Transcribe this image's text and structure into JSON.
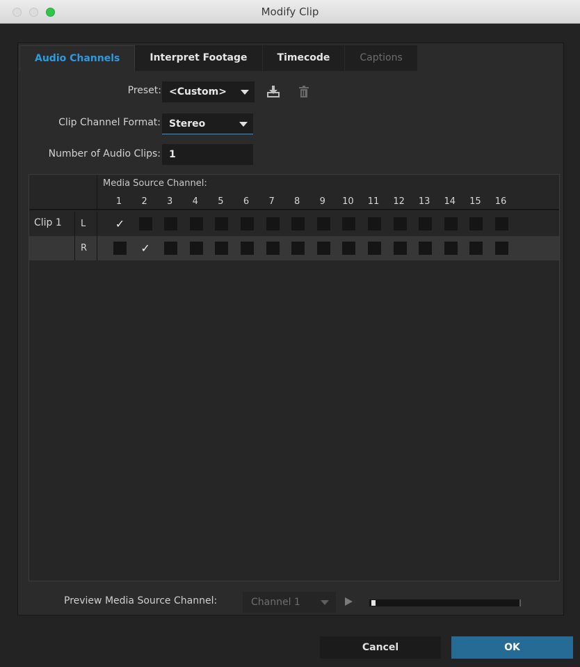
{
  "window": {
    "title": "Modify Clip"
  },
  "tabs": [
    {
      "label": "Audio Channels",
      "state": "active"
    },
    {
      "label": "Interpret Footage",
      "state": "normal"
    },
    {
      "label": "Timecode",
      "state": "normal"
    },
    {
      "label": "Captions",
      "state": "disabled"
    }
  ],
  "preset": {
    "label": "Preset:",
    "value": "<Custom>",
    "save_icon": "save-preset-icon",
    "delete_icon": "trash-icon"
  },
  "channel_format": {
    "label": "Clip Channel Format:",
    "value": "Stereo"
  },
  "audio_clips": {
    "label": "Number of Audio Clips:",
    "value": "1"
  },
  "grid": {
    "header": "Media Source Channel:",
    "channels": [
      "1",
      "2",
      "3",
      "4",
      "5",
      "6",
      "7",
      "8",
      "9",
      "10",
      "11",
      "12",
      "13",
      "14",
      "15",
      "16"
    ],
    "clip_label": "Clip 1",
    "rows": [
      {
        "channel": "L",
        "checked": [
          1
        ]
      },
      {
        "channel": "R",
        "checked": [
          2
        ]
      }
    ]
  },
  "preview": {
    "label": "Preview Media Source Channel:",
    "value": "Channel 1"
  },
  "buttons": {
    "cancel": "Cancel",
    "ok": "OK"
  },
  "colors": {
    "accent": "#2d9ae0",
    "ok_button": "#256b95"
  }
}
